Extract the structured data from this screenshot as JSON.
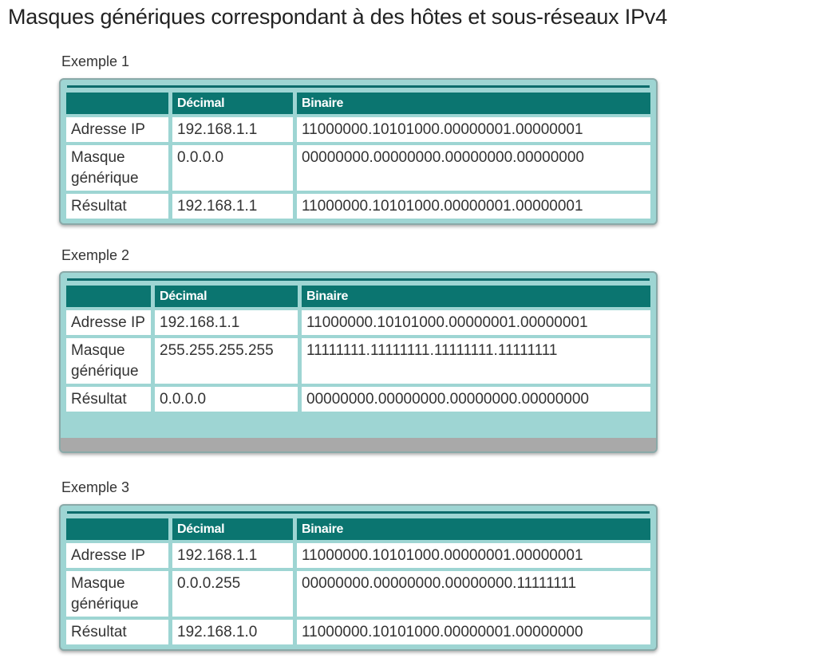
{
  "page_title": "Masques génériques correspondant à des hôtes et sous-réseaux IPv4",
  "columns": [
    "",
    "Décimal",
    "Binaire"
  ],
  "examples": [
    {
      "label": "Exemple 1",
      "rows": [
        {
          "name": "Adresse IP",
          "decimal": "192.168.1.1",
          "binary": "11000000.10101000.00000001.00000001"
        },
        {
          "name": "Masque générique",
          "decimal": "0.0.0.0",
          "binary": "00000000.00000000.00000000.00000000"
        },
        {
          "name": "Résultat",
          "decimal": "192.168.1.1",
          "binary": "11000000.10101000.00000001.00000001"
        }
      ]
    },
    {
      "label": "Exemple 2",
      "rows": [
        {
          "name": "Adresse IP",
          "decimal": "192.168.1.1",
          "binary": "11000000.10101000.00000001.00000001"
        },
        {
          "name": "Masque générique",
          "decimal": "255.255.255.255",
          "binary": "11111111.11111111.11111111.11111111"
        },
        {
          "name": "Résultat",
          "decimal": "0.0.0.0",
          "binary": "00000000.00000000.00000000.00000000"
        }
      ]
    },
    {
      "label": "Exemple 3",
      "rows": [
        {
          "name": "Adresse IP",
          "decimal": "192.168.1.1",
          "binary": "11000000.10101000.00000001.00000001"
        },
        {
          "name": "Masque générique",
          "decimal": "0.0.0.255",
          "binary": "00000000.00000000.00000000.11111111"
        },
        {
          "name": "Résultat",
          "decimal": "192.168.1.0",
          "binary": "11000000.10101000.00000001.00000000"
        }
      ]
    }
  ],
  "colors": {
    "header": "#0b7570",
    "frame": "#9ed5d3",
    "accent_line": "#0c6b6b"
  }
}
